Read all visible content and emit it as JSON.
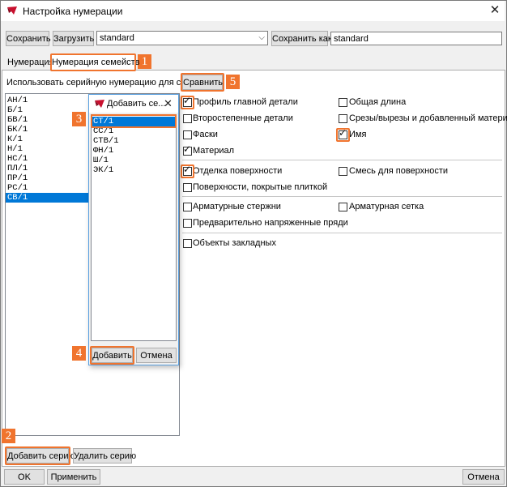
{
  "window": {
    "title": "Настройка нумерации",
    "close_glyph": "✕",
    "app_icon": "tekla-icon"
  },
  "toolbar": {
    "save_label": "Сохранить",
    "load_label": "Загрузить",
    "preset_value": "standard",
    "saveas_label": "Сохранить как",
    "saveas_value": "standard"
  },
  "tabs": [
    {
      "label": "Нумерация"
    },
    {
      "label": "Нумерация семейств"
    }
  ],
  "series_prompt": "Использовать серийную нумерацию для серий:",
  "compare_label": "Сравнить",
  "series_list": [
    "АН/1",
    "Б/1",
    "БВ/1",
    "БК/1",
    "К/1",
    "Н/1",
    "НС/1",
    "ПЛ/1",
    "ПР/1",
    "РС/1",
    "СВ/1"
  ],
  "series_selected": "СВ/1",
  "add_dialog": {
    "title": "Добавить се...",
    "close_glyph": "✕",
    "items": [
      "СТ/1",
      "СС/1",
      "СТВ/1",
      "ФН/1",
      "Ш/1",
      "ЭК/1"
    ],
    "selected": "СТ/1",
    "add_label": "Добавить",
    "cancel_label": "Отмена"
  },
  "options": {
    "group1": [
      {
        "label": "Профиль главной детали",
        "checked": true
      },
      {
        "label": "Общая длина",
        "checked": false
      },
      {
        "label": "Второстепенные детали",
        "checked": false
      },
      {
        "label": "Срезы/вырезы и добавленный материал",
        "checked": false
      },
      {
        "label": "Фаски",
        "checked": false
      },
      {
        "label": "Имя",
        "checked": true
      },
      {
        "label": "Материал",
        "checked": true
      }
    ],
    "group2": [
      {
        "label": "Отделка поверхности",
        "checked": true
      },
      {
        "label": "Смесь для поверхности",
        "checked": false
      },
      {
        "label": "Поверхности, покрытые плиткой",
        "checked": false
      }
    ],
    "group3": [
      {
        "label": "Арматурные стержни",
        "checked": false
      },
      {
        "label": "Арматурная сетка",
        "checked": false
      },
      {
        "label": "Предварительно напряженные пряди",
        "checked": false
      }
    ],
    "group4": [
      {
        "label": "Объекты закладных",
        "checked": false
      }
    ]
  },
  "add_series_label": "Добавить серию",
  "remove_series_label": "Удалить серию",
  "footer": {
    "ok_label": "OK",
    "apply_label": "Применить",
    "cancel_label": "Отмена"
  },
  "callouts": [
    "1",
    "2",
    "3",
    "4",
    "5"
  ],
  "accent_color": "#f0742e",
  "selection_color": "#0078d7"
}
